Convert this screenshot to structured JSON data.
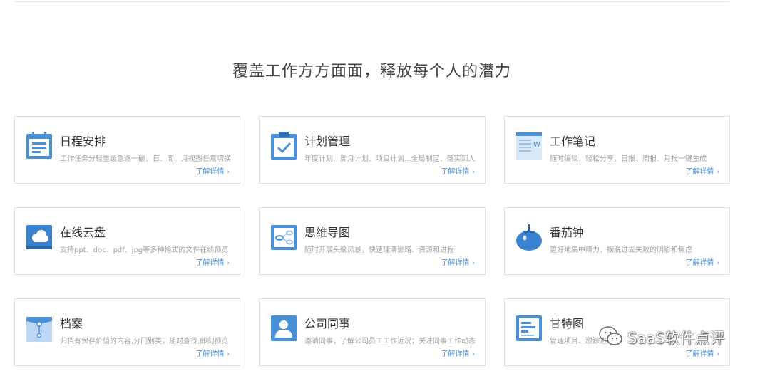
{
  "section_title": "覆盖工作方方面面，释放每个人的潜力",
  "more_label": "了解详情",
  "more_chevron": "›",
  "accent_color": "#4a90d9",
  "cards": [
    {
      "title": "日程安排",
      "desc": "工作任务分轻重缓急逐一破，日、周、月视图任意切换",
      "icon": "calendar-icon"
    },
    {
      "title": "计划管理",
      "desc": "年度计划、周月计划、项目计划...全局制定，落实到人",
      "icon": "clipboard-check-icon"
    },
    {
      "title": "工作笔记",
      "desc": "随时编辑，轻松分享，日报、周报、月报一键生成",
      "icon": "notebook-icon"
    },
    {
      "title": "在线云盘",
      "desc": "支持ppt、doc、pdf、jpg等多种格式的文件在线预览",
      "icon": "cloud-drive-icon"
    },
    {
      "title": "思维导图",
      "desc": "随时开展头脑风暴，快速理清思路、资源和进程",
      "icon": "mind-map-icon"
    },
    {
      "title": "番茄钟",
      "desc": "更好地集中精力，摆脱过去失败的阴影和焦虑",
      "icon": "tomato-icon"
    },
    {
      "title": "档案",
      "desc": "归档有保存价值的内容,分门别类，随时查找,即刻预览",
      "icon": "archive-folder-icon"
    },
    {
      "title": "公司同事",
      "desc": "邀请同事，了解公司员工工作近况；关注同事工作动态",
      "icon": "colleague-icon"
    },
    {
      "title": "甘特图",
      "desc": "管理项目、跟踪进度",
      "icon": "gantt-chart-icon"
    }
  ],
  "watermark": {
    "text": "SaaS软件点评",
    "icon": "wechat-icon"
  }
}
